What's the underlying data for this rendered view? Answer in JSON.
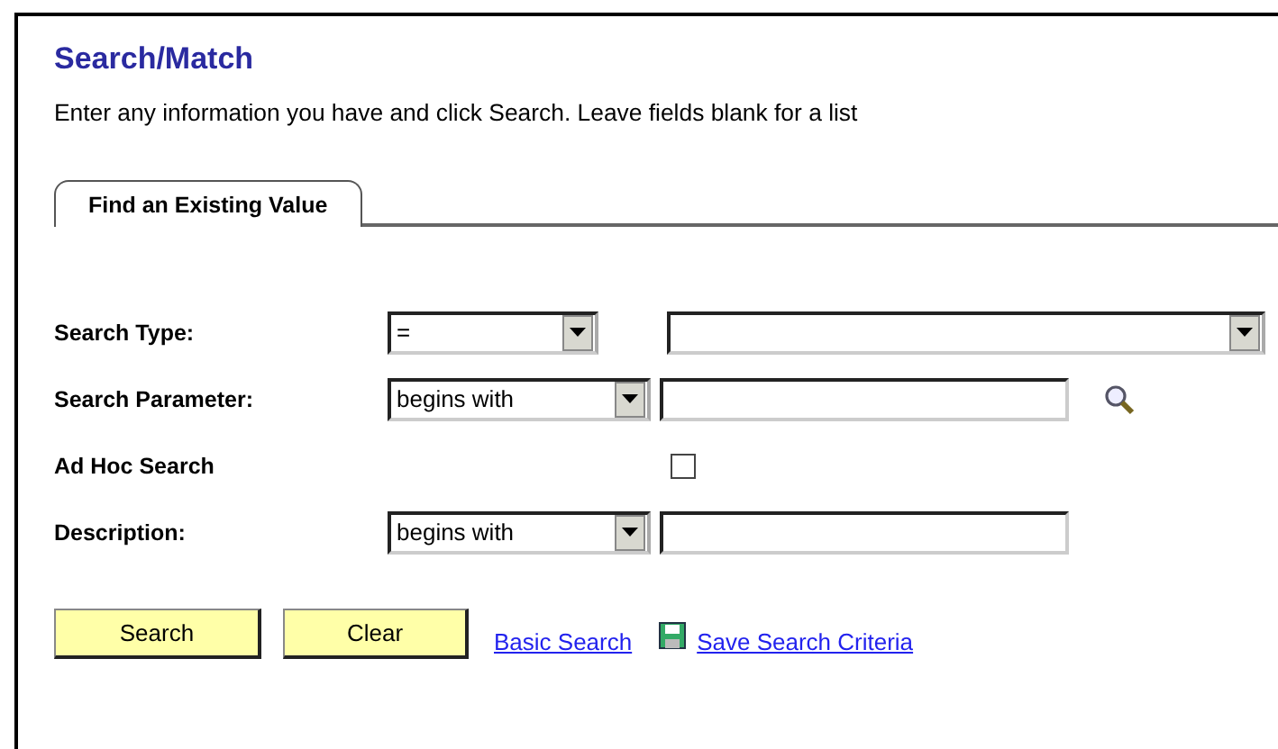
{
  "title": "Search/Match",
  "instructions": "Enter any information you have and click Search. Leave fields blank for a list",
  "tabs": [
    {
      "label": "Find an Existing Value",
      "selected": true
    }
  ],
  "fields": [
    {
      "kind": "select-pair",
      "label": "Search Type:",
      "operator": "="
    },
    {
      "kind": "lookup",
      "label": "Search Parameter:",
      "operator": "begins with"
    },
    {
      "kind": "checkbox",
      "label": "Ad Hoc Search",
      "checked": false
    },
    {
      "kind": "text",
      "label": "Description:",
      "operator": "begins with"
    }
  ],
  "buttons": [
    "Search",
    "Clear"
  ],
  "links": [
    {
      "kind": "plain",
      "label": "Basic Search"
    },
    {
      "kind": "save",
      "label": "Save Search Criteria"
    }
  ]
}
